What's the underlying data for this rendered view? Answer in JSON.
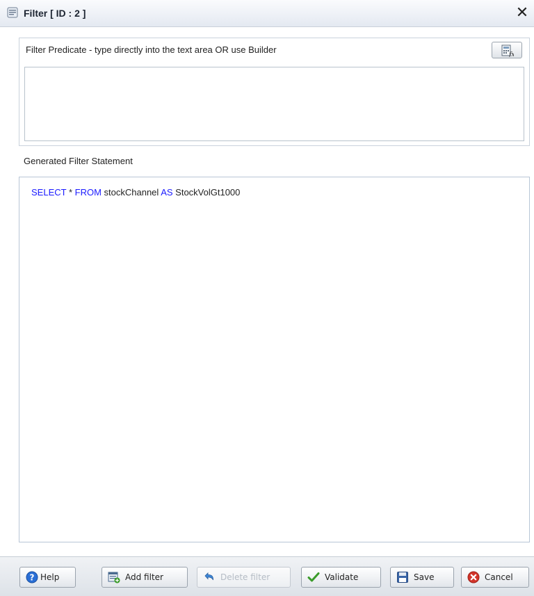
{
  "window": {
    "title": "Filter [ ID : 2 ]",
    "close_glyph": "✕"
  },
  "predicate": {
    "label": "Filter Predicate - type directly into the text area OR use Builder",
    "value": "",
    "builder_icon": "expression-builder-icon"
  },
  "generated": {
    "label": "Generated Filter Statement",
    "tokens": [
      {
        "text": "SELECT",
        "keyword": true
      },
      {
        "text": " * ",
        "keyword": false
      },
      {
        "text": "FROM",
        "keyword": true
      },
      {
        "text": " stockChannel ",
        "keyword": false
      },
      {
        "text": "AS",
        "keyword": true
      },
      {
        "text": " StockVolGt1000",
        "keyword": false
      }
    ]
  },
  "footer": {
    "help": "Help",
    "add_filter": "Add filter",
    "delete_filter": "Delete filter",
    "validate": "Validate",
    "save": "Save",
    "cancel": "Cancel"
  },
  "colors": {
    "keyword": "#1a1aff",
    "help_icon": "#2a6fd6",
    "validate_check": "#3a9b2a",
    "cancel_icon": "#d2342a"
  }
}
